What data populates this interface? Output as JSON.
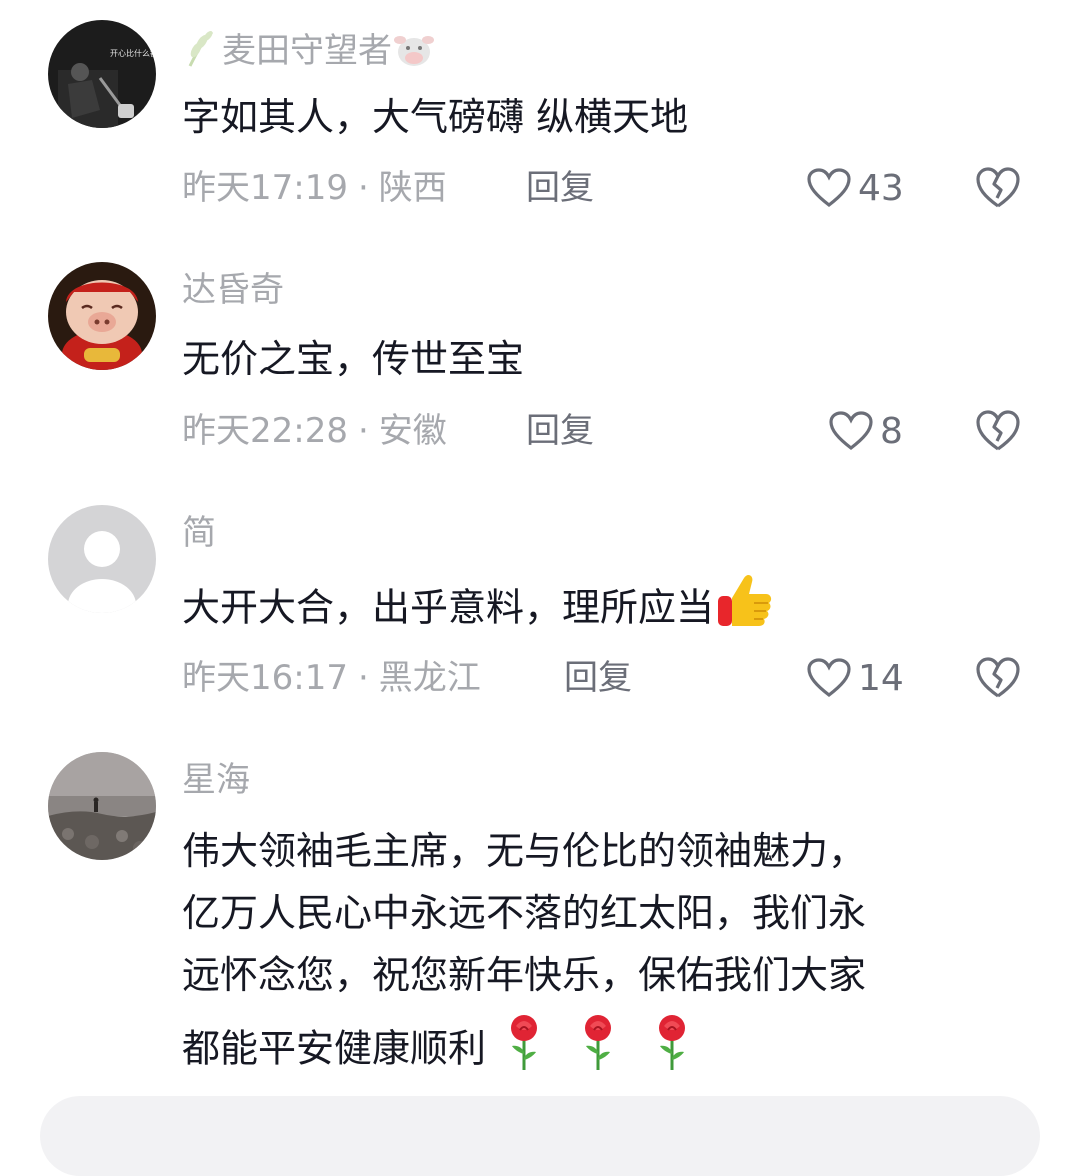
{
  "comments": [
    {
      "username": "麦田守望者",
      "avatar_caption": "开心比什么都贵",
      "text": "字如其人，大气磅礴 纵横天地",
      "time": "昨天17:19",
      "location": "陕西",
      "reply_label": "回复",
      "likes": "43"
    },
    {
      "username": "达昏奇",
      "text": "无价之宝，传世至宝",
      "time": "昨天22:28",
      "location": "安徽",
      "reply_label": "回复",
      "likes": "8"
    },
    {
      "username": "简",
      "text": "大开大合，出乎意料，理所应当",
      "time": "昨天16:17",
      "location": "黑龙江",
      "reply_label": "回复",
      "likes": "14"
    },
    {
      "username": "星海",
      "text_lines": [
        "伟大领袖毛主席，无与伦比的领袖魅力，",
        "亿万人民心中永远不落的红太阳，我们永",
        "远怀念您，祝您新年快乐，保佑我们大家",
        "都能平安健康顺利"
      ]
    }
  ],
  "icons": {
    "like": "heart-outline-icon",
    "dislike": "broken-heart-icon",
    "thumbs_up": "thumbs-up-emoji",
    "rose": "rose-emoji",
    "wheat": "wheat-icon",
    "cow": "cow-emoji"
  },
  "separator": "·",
  "colors": {
    "primary_text": "#161823",
    "secondary_text": "#a6a8ad",
    "action_text": "#6b6e78"
  }
}
